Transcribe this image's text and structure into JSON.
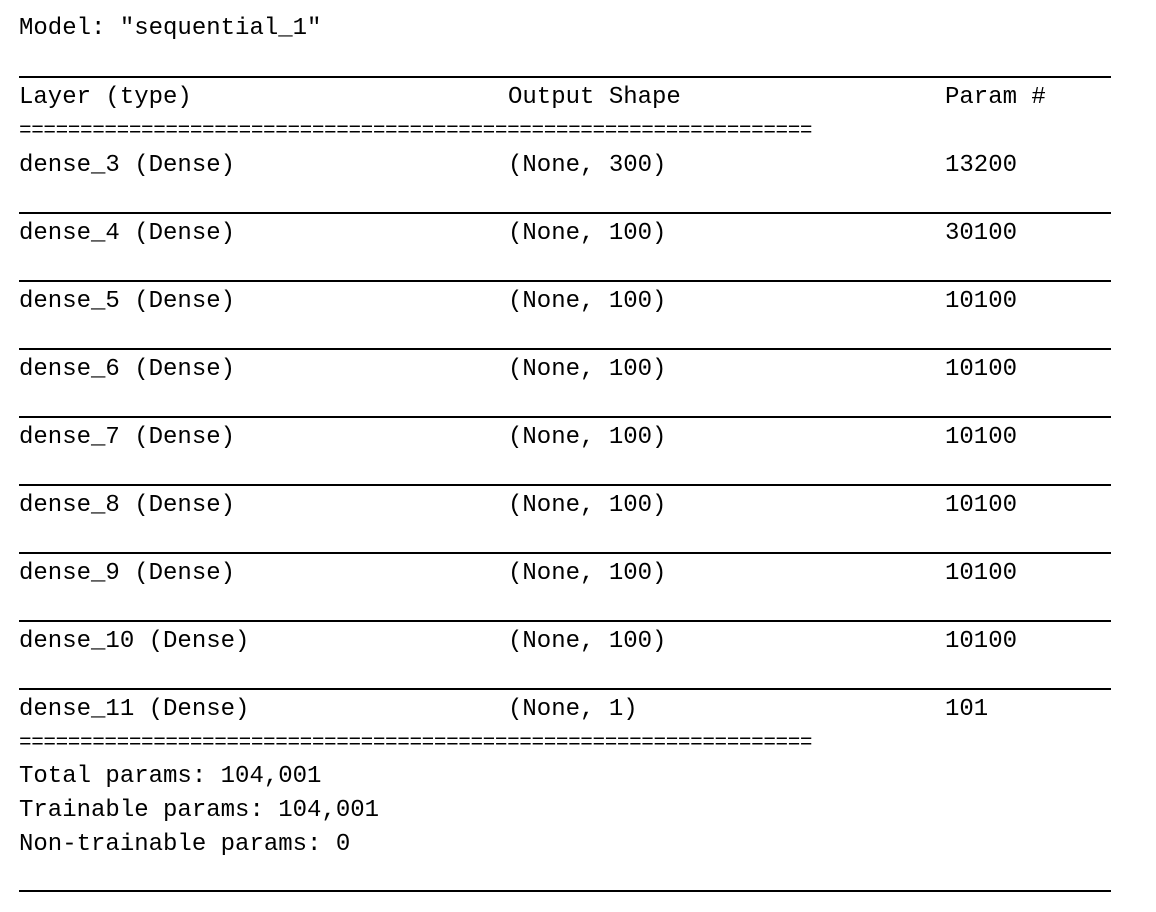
{
  "model_title": "Model: \"sequential_1\"",
  "headers": {
    "layer": "Layer (type)",
    "output_shape": "Output Shape",
    "params": "Param #"
  },
  "rows": [
    {
      "layer": "dense_3 (Dense)",
      "shape": "(None, 300)",
      "params": "13200"
    },
    {
      "layer": "dense_4 (Dense)",
      "shape": "(None, 100)",
      "params": "30100"
    },
    {
      "layer": "dense_5 (Dense)",
      "shape": "(None, 100)",
      "params": "10100"
    },
    {
      "layer": "dense_6 (Dense)",
      "shape": "(None, 100)",
      "params": "10100"
    },
    {
      "layer": "dense_7 (Dense)",
      "shape": "(None, 100)",
      "params": "10100"
    },
    {
      "layer": "dense_8 (Dense)",
      "shape": "(None, 100)",
      "params": "10100"
    },
    {
      "layer": "dense_9 (Dense)",
      "shape": "(None, 100)",
      "params": "10100"
    },
    {
      "layer": "dense_10 (Dense)",
      "shape": "(None, 100)",
      "params": "10100"
    },
    {
      "layer": "dense_11 (Dense)",
      "shape": "(None, 1)",
      "params": "101"
    }
  ],
  "summary": {
    "total": "Total params: 104,001",
    "trainable": "Trainable params: 104,001",
    "non_trainable": "Non-trainable params: 0"
  },
  "separator_double": "================================================================="
}
